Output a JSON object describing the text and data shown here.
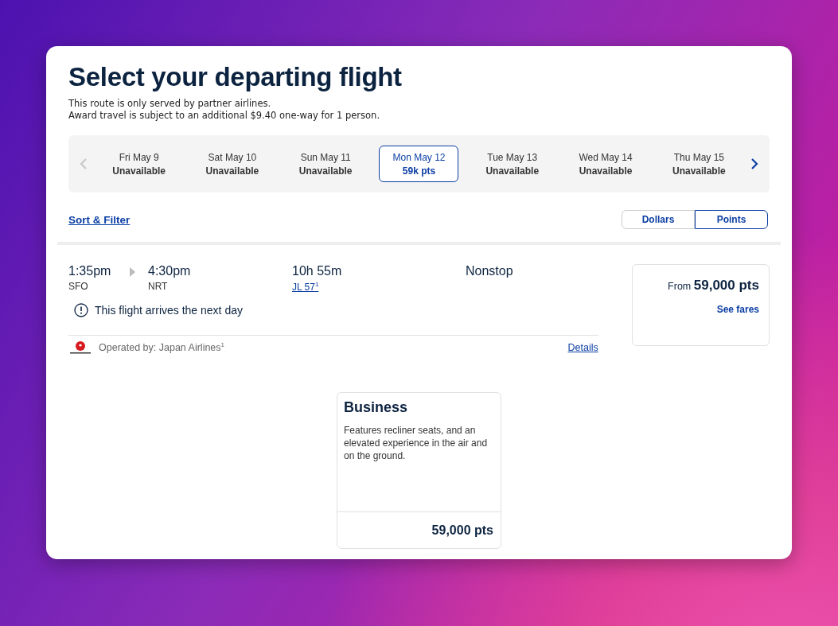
{
  "header": {
    "title": "Select your departing flight",
    "notes": [
      "This route is only served by partner airlines.",
      "Award travel is subject to an additional $9.40 one-way for 1 person."
    ]
  },
  "date_strip": {
    "prev_disabled": true,
    "next_disabled": false,
    "dates": [
      {
        "day": "Fri May 9",
        "price": "Unavailable",
        "selected": false
      },
      {
        "day": "Sat May 10",
        "price": "Unavailable",
        "selected": false
      },
      {
        "day": "Sun May 11",
        "price": "Unavailable",
        "selected": false
      },
      {
        "day": "Mon May 12",
        "price": "59k pts",
        "selected": true
      },
      {
        "day": "Tue May 13",
        "price": "Unavailable",
        "selected": false
      },
      {
        "day": "Wed May 14",
        "price": "Unavailable",
        "selected": false
      },
      {
        "day": "Thu May 15",
        "price": "Unavailable",
        "selected": false
      }
    ]
  },
  "sort_filter": "Sort & Filter",
  "currency_toggle": [
    {
      "label": "Dollars",
      "selected": false
    },
    {
      "label": "Points",
      "selected": true
    }
  ],
  "flight": {
    "depart_time": "1:35pm",
    "depart_airport": "SFO",
    "arrive_time": "4:30pm",
    "arrive_airport": "NRT",
    "duration": "10h 55m",
    "flight_number": "JL 57$^{1}$",
    "stops": "Nonstop",
    "notice": "This flight arrives the next day",
    "operated_by": "Operated by: Japan Airlines$^{1}$",
    "details": "Details",
    "price_prefix": "From",
    "price": "59,000 pts",
    "see_fares": "See fares"
  },
  "fares": [
    {
      "cabin": "Business",
      "description": "Features recliner seats, and an elevated experience in the air and on the ground.",
      "price": "59,000 pts"
    }
  ]
}
